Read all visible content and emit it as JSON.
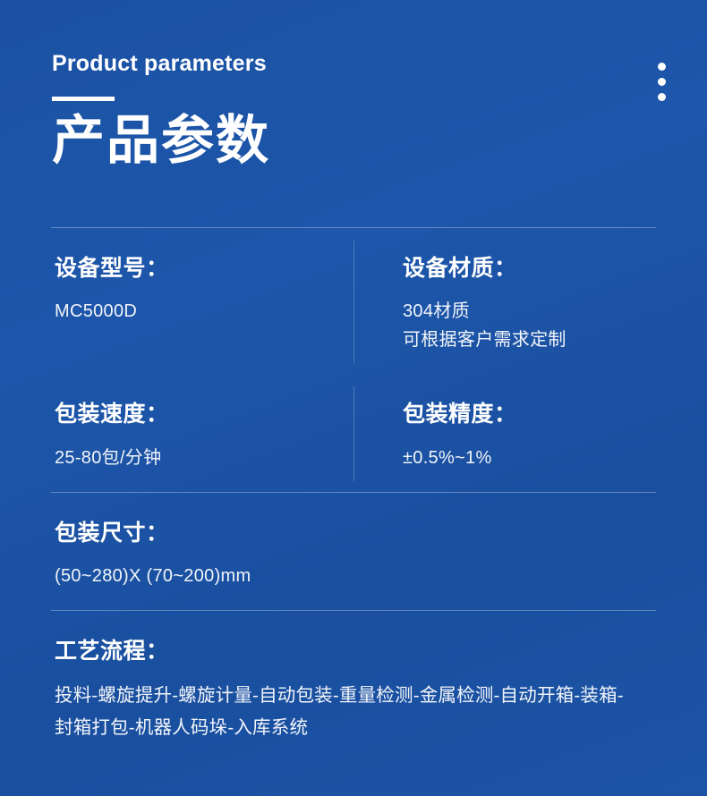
{
  "header": {
    "eyebrow": "Product parameters",
    "title_cn": "产品参数"
  },
  "menu": {
    "icon": "more-vertical-icon",
    "dot_count": 3
  },
  "specs": [
    {
      "label": "设备型号：",
      "values": [
        "MC5000D"
      ]
    },
    {
      "label": "设备材质：",
      "values": [
        "304材质",
        "可根据客户需求定制"
      ]
    },
    {
      "label": "包装速度：",
      "values": [
        "25-80包/分钟"
      ]
    },
    {
      "label": "包装精度：",
      "values": [
        "±0.5%~1%"
      ]
    },
    {
      "label": "包装尺寸：",
      "values": [
        "(50~280)X (70~200)mm"
      ]
    }
  ],
  "process": {
    "label": "工艺流程：",
    "text": "投料-螺旋提升-螺旋计量-自动包装-重量检测-金属检测-自动开箱-装箱-封箱打包-机器人码垛-入库系统"
  },
  "colors": {
    "background": "#1d54a5",
    "text": "#ffffff",
    "divider": "rgba(255,255,255,0.32)"
  }
}
